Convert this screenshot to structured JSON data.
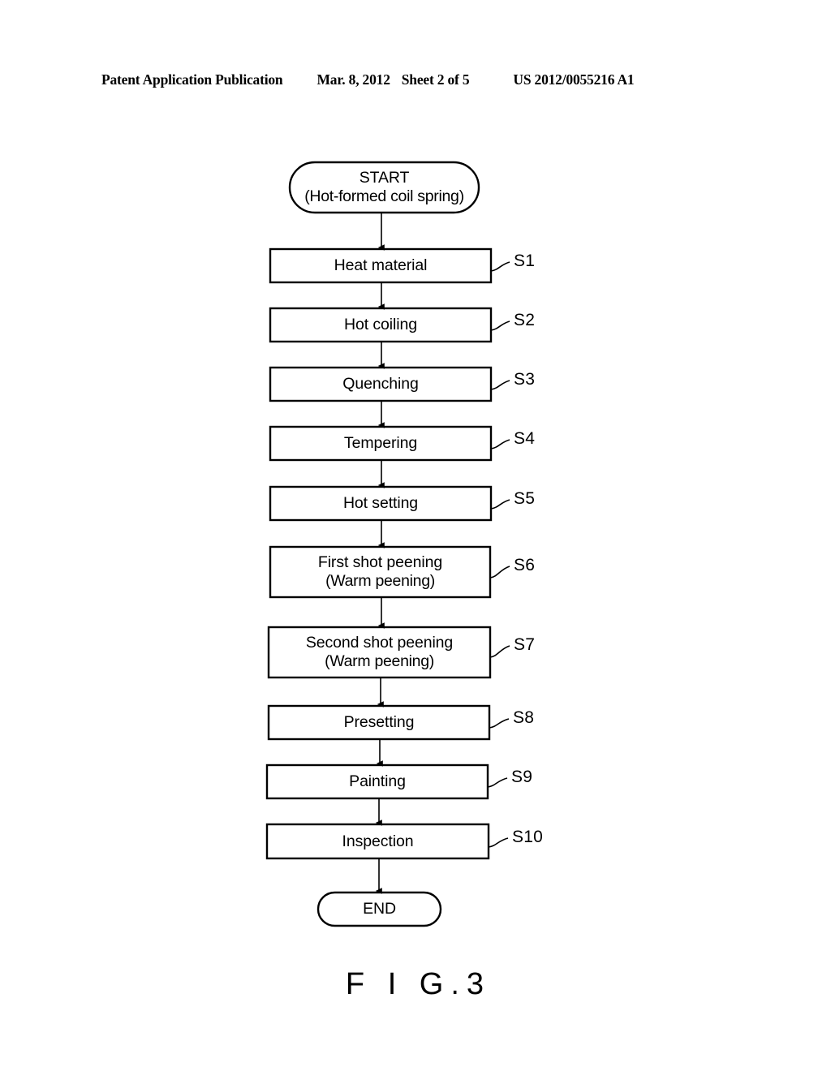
{
  "header": {
    "publication": "Patent Application Publication",
    "date": "Mar. 8, 2012",
    "sheet": "Sheet 2 of 5",
    "document_number": "US 2012/0055216 A1"
  },
  "figure": {
    "caption_prefix": "F I G.",
    "caption_number": "3",
    "ink_color": "#000000",
    "background_color": "#ffffff"
  },
  "flowchart": {
    "start": {
      "shape": "stadium",
      "line1": "START",
      "line2": "(Hot-formed coil spring)"
    },
    "end": {
      "shape": "stadium",
      "line1": "END"
    },
    "steps": [
      {
        "id": "S1",
        "line1": "Heat material",
        "line2": ""
      },
      {
        "id": "S2",
        "line1": "Hot coiling",
        "line2": ""
      },
      {
        "id": "S3",
        "line1": "Quenching",
        "line2": ""
      },
      {
        "id": "S4",
        "line1": "Tempering",
        "line2": ""
      },
      {
        "id": "S5",
        "line1": "Hot setting",
        "line2": ""
      },
      {
        "id": "S6",
        "line1": "First shot peening",
        "line2": "(Warm peening)"
      },
      {
        "id": "S7",
        "line1": "Second shot peening",
        "line2": "(Warm peening)"
      },
      {
        "id": "S8",
        "line1": "Presetting",
        "line2": ""
      },
      {
        "id": "S9",
        "line1": "Painting",
        "line2": ""
      },
      {
        "id": "S10",
        "line1": "Inspection",
        "line2": ""
      }
    ]
  }
}
